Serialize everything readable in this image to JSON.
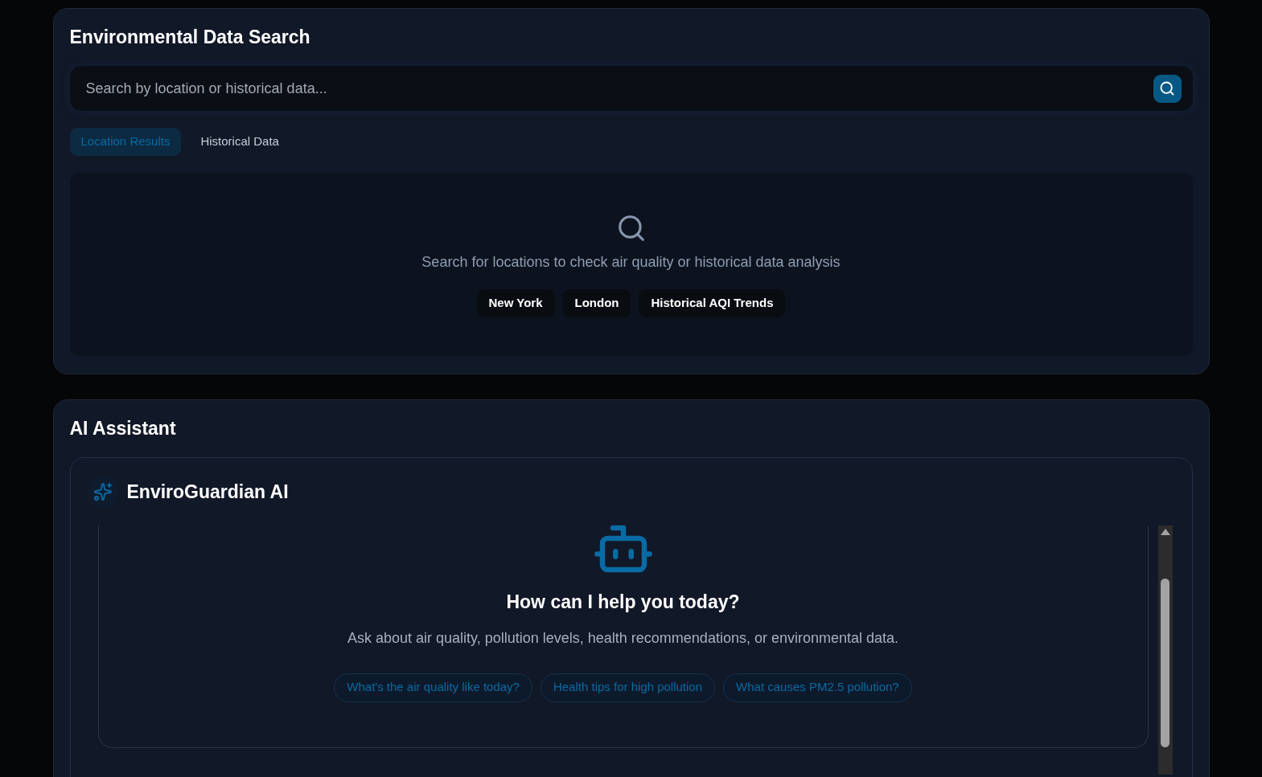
{
  "search_panel": {
    "title": "Environmental Data Search",
    "search": {
      "placeholder": "Search by location or historical data..."
    },
    "tabs": [
      {
        "label": "Location Results",
        "selected": true
      },
      {
        "label": "Historical Data",
        "selected": false
      }
    ],
    "empty_state": {
      "message": "Search for locations to check air quality or historical data analysis",
      "suggestions": [
        "New York",
        "London",
        "Historical AQI Trends"
      ]
    }
  },
  "assistant_panel": {
    "title": "AI Assistant",
    "chat": {
      "name": "EnviroGuardian AI",
      "heading": "How can I help you today?",
      "subtitle": "Ask about air quality, pollution levels, health recommendations, or environmental data.",
      "prompts": [
        "What's the air quality like today?",
        "Health tips for high pollution",
        "What causes PM2.5 pollution?"
      ]
    }
  }
}
